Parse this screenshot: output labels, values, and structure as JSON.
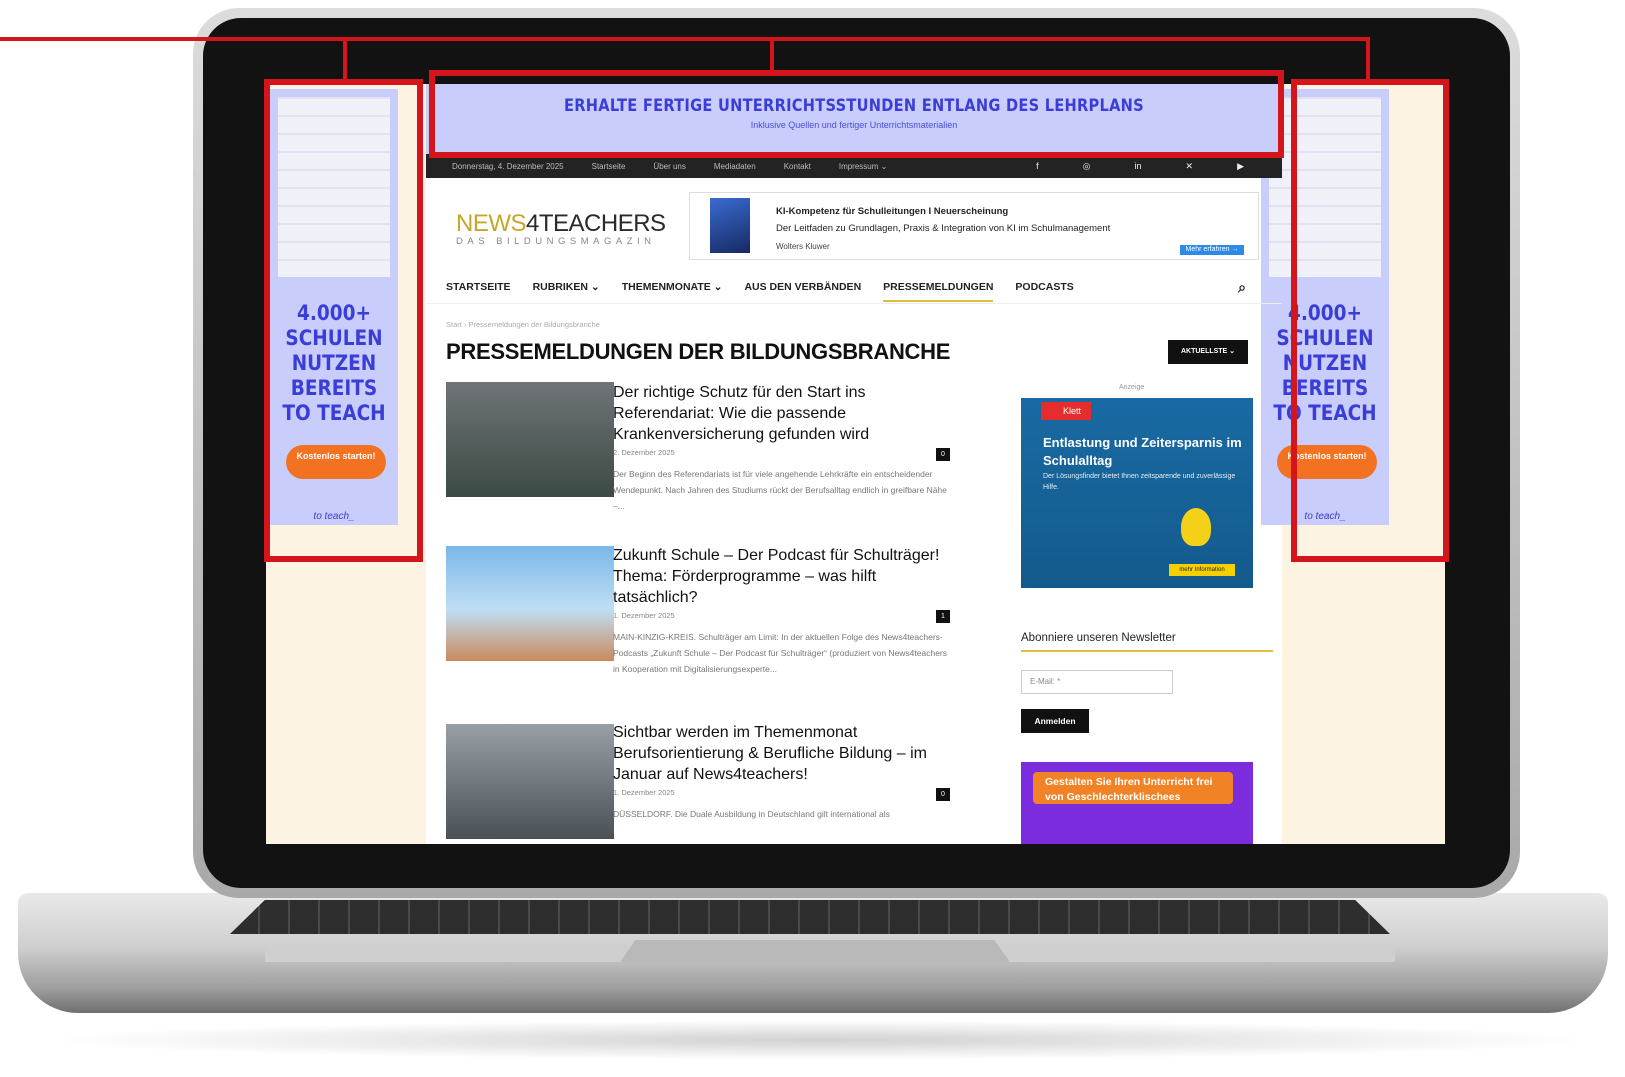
{
  "colors": {
    "highlight": "#d4151b",
    "ad_bg": "#c9cdfb",
    "ad_text": "#3b3ed6",
    "accent": "#e0bd3a"
  },
  "top_ad": {
    "title": "ERHALTE FERTIGE UNTERRICHTSSTUNDEN ENTLANG DES LEHRPLANS",
    "subtitle": "Inklusive Quellen und fertiger Unterrichtsmaterialien"
  },
  "topbar": {
    "date": "Donnerstag, 4. Dezember 2025",
    "links": [
      "Startseite",
      "Über uns",
      "Mediadaten",
      "Kontakt",
      "Impressum ⌄"
    ],
    "social_icons": [
      "facebook-icon",
      "instagram-icon",
      "linkedin-icon",
      "x-icon",
      "youtube-icon"
    ]
  },
  "logo": {
    "part1": "NEWS",
    "part2": "4TEACHERS",
    "tagline": "DAS BILDUNGSMAGAZIN"
  },
  "header_ad": {
    "headline": "KI-Kompetenz für Schulleitungen I Neuerscheinung",
    "text": "Der Leitfaden zu Grundlagen, Praxis & Integration von KI im Schulmanagement",
    "brand": "Wolters Kluwer",
    "button": "Mehr erfahren →"
  },
  "nav": {
    "items": [
      "STARTSEITE",
      "RUBRIKEN ⌄",
      "THEMENMONATE ⌄",
      "AUS DEN VERBÄNDEN",
      "PRESSEMELDUNGEN",
      "PODCASTS"
    ],
    "search_icon": "search-icon"
  },
  "breadcrumb": "Start › Pressemeldungen der Bildungsbranche",
  "page_title": "PRESSEMELDUNGEN DER BILDUNGSBRANCHE",
  "sort_button": "AKTUELLSTE ⌄",
  "articles": [
    {
      "title": "Der richtige Schutz für den Start ins Referendariat: Wie die passende Krankenversicherung gefunden wird",
      "date": "2. Dezember 2025",
      "comments": "0",
      "excerpt": "Der Beginn des Referendariats ist für viele angehende Lehrkräfte ein entscheidender Wendepunkt. Nach Jahren des Studiums rückt der Berufsalltag endlich in greifbare Nähe –..."
    },
    {
      "title": "Zukunft Schule – Der Podcast für Schulträger! Thema: Förderprogramme – was hilft tatsächlich?",
      "date": "1. Dezember 2025",
      "comments": "1",
      "excerpt": "MAIN-KINZIG-KREIS. Schulträger am Limit: In der aktuellen Folge des News4teachers-Podcasts „Zukunft Schule – Der Podcast für Schulträger“ (produziert von News4teachers in Kooperation mit Digitalisierungsexperte..."
    },
    {
      "title": "Sichtbar werden im Themenmonat Berufsorientierung & Berufliche Bildung – im Januar auf News4teachers!",
      "date": "1. Dezember 2025",
      "comments": "0",
      "excerpt": "DÜSSELDORF. Die Duale Ausbildung in Deutschland gilt international als"
    }
  ],
  "sidebar": {
    "ad_label": "Anzeige",
    "klett": {
      "logo": "Klett",
      "headline": "Entlastung und Zeitersparnis im Schulalltag",
      "text": "Der Lösungsfinder bietet Ihnen zeitsparende und zuverlässige Hilfe.",
      "button": "mehr Information"
    },
    "newsletter": {
      "heading": "Abonniere unseren Newsletter",
      "email_placeholder": "E-Mail: *",
      "button": "Anmelden"
    },
    "promo": "Gestalten Sie Ihren Unterricht frei von Geschlechterklischees"
  },
  "side_ad": {
    "headline": "4.000+ SCHULEN NUTZEN BEREITS TO TEACH",
    "button": "Kostenlos starten!",
    "brand": "to teach_"
  }
}
